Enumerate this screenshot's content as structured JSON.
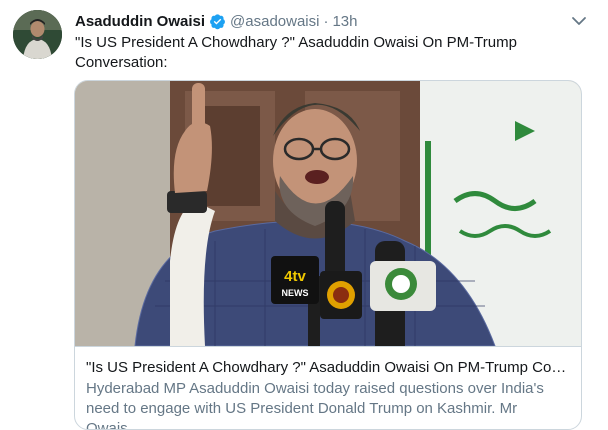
{
  "tweet": {
    "author_name": "Asaduddin Owaisi",
    "handle": "@asadowaisi",
    "separator": "·",
    "time": "13h",
    "text": "\"Is US President A Chowdhary ?\" Asaduddin Owaisi On PM-Trump Conversation:",
    "icons": {
      "verified": "verified-badge-icon",
      "caret": "chevron-down-icon"
    },
    "colors": {
      "verified": "#1da1f2",
      "secondary_text": "#657786",
      "border": "#ccd6dd"
    }
  },
  "card": {
    "image_alt": "Man in cap and glasses speaking at microphones with finger raised",
    "mic_labels": [
      "4tv",
      "NEWS"
    ],
    "title": "\"Is US President A Chowdhary ?\" Asaduddin Owaisi On PM-Trump Conv...",
    "description": "Hyderabad MP Asaduddin Owaisi today raised questions over India's need to engage with US President Donald Trump on Kashmir. Mr Owais..."
  }
}
